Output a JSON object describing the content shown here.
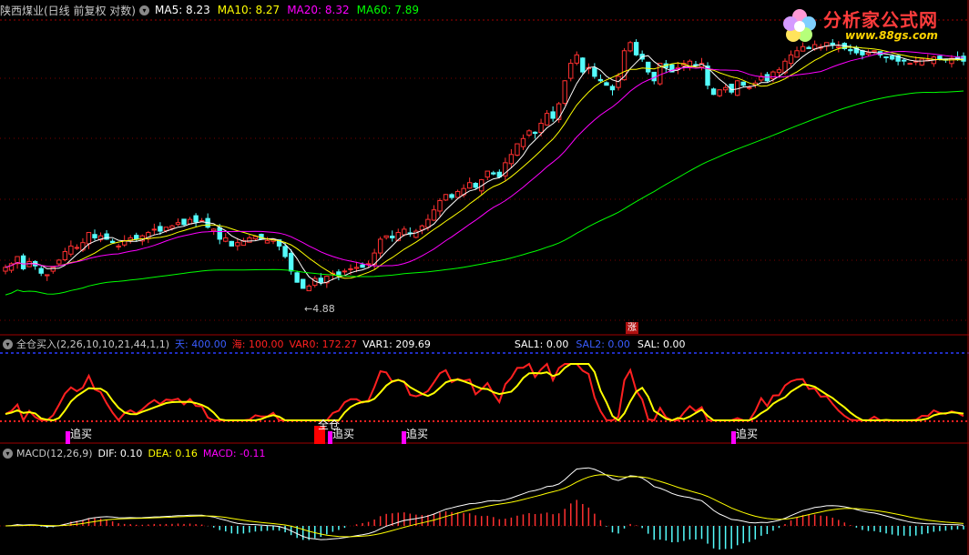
{
  "watermark": {
    "brand": "分析家公式网",
    "url": "www.88gs.com"
  },
  "main_panel": {
    "title": "陕西煤业(日线 前复权 对数)",
    "indicators": [
      {
        "label": "MA5: 8.23",
        "color": "#ffffff"
      },
      {
        "label": "MA10: 8.27",
        "color": "#ffff00"
      },
      {
        "label": "MA20: 8.32",
        "color": "#ff00ff"
      },
      {
        "label": "MA60: 7.89",
        "color": "#00ff00"
      }
    ],
    "low_marker": "←4.88",
    "zhang_tag": "涨"
  },
  "sub_panel": {
    "title": "全仓买入(2,26,10,10,21,44,1,1)",
    "indicators": [
      {
        "label": "天: 400.00",
        "color": "#3a5cff"
      },
      {
        "label": "海: 100.00",
        "color": "#ff2020"
      },
      {
        "label": "VAR0: 172.27",
        "color": "#ff2020"
      },
      {
        "label": "VAR1: 209.69",
        "color": "#ffffff"
      },
      {
        "label": "SAL1: 0.00",
        "color": "#ffffff"
      },
      {
        "label": "SAL2: 0.00",
        "color": "#3a5cff"
      },
      {
        "label": "SAL: 0.00",
        "color": "#ffffff"
      }
    ],
    "signals": [
      "追买",
      "全仓",
      "追买",
      "追买",
      "追买"
    ]
  },
  "macd_panel": {
    "title": "MACD(12,26,9)",
    "indicators": [
      {
        "label": "DIF: 0.10",
        "color": "#ffffff"
      },
      {
        "label": "DEA: 0.16",
        "color": "#ffff00"
      },
      {
        "label": "MACD: -0.11",
        "color": "#ff00ff"
      }
    ]
  },
  "colors": {
    "up": "#ff3030",
    "down": "#54fcfc",
    "ma5": "#ffffff",
    "ma10": "#ffff00",
    "ma20": "#ff00ff",
    "ma60": "#00ff00",
    "grid": "#7a0000",
    "border": "#a00000"
  },
  "chart_data": {
    "type": "candlestick",
    "close": [
      5.2,
      5.25,
      5.35,
      5.18,
      5.28,
      5.22,
      5.12,
      5.1,
      5.2,
      5.3,
      5.42,
      5.5,
      5.48,
      5.55,
      5.7,
      5.62,
      5.65,
      5.6,
      5.55,
      5.5,
      5.58,
      5.62,
      5.6,
      5.65,
      5.7,
      5.75,
      5.72,
      5.78,
      5.8,
      5.85,
      5.82,
      5.9,
      5.86,
      5.88,
      5.78,
      5.75,
      5.6,
      5.62,
      5.5,
      5.55,
      5.58,
      5.62,
      5.64,
      5.6,
      5.58,
      5.6,
      5.5,
      5.35,
      5.15,
      5.0,
      4.92,
      4.95,
      5.05,
      5.0,
      5.08,
      5.12,
      5.1,
      5.15,
      5.18,
      5.2,
      5.2,
      5.25,
      5.4,
      5.6,
      5.65,
      5.62,
      5.7,
      5.75,
      5.68,
      5.72,
      5.8,
      5.9,
      6.05,
      6.2,
      6.3,
      6.25,
      6.35,
      6.4,
      6.5,
      6.42,
      6.55,
      6.7,
      6.65,
      6.6,
      6.85,
      7.0,
      7.2,
      7.3,
      7.45,
      7.4,
      7.6,
      7.8,
      7.7,
      8.0,
      8.5,
      8.9,
      9.1,
      8.7,
      8.8,
      8.6,
      8.5,
      8.4,
      8.3,
      8.6,
      9.2,
      9.4,
      9.1,
      9.0,
      8.7,
      8.5,
      8.9,
      8.8,
      8.7,
      8.8,
      8.9,
      8.95,
      8.85,
      8.9,
      8.4,
      8.2,
      8.3,
      8.35,
      8.25,
      8.5,
      8.4,
      8.35,
      8.45,
      8.6,
      8.5,
      8.7,
      8.75,
      8.95,
      9.1,
      9.2,
      9.3,
      9.25,
      9.35,
      9.3,
      9.4,
      9.35,
      9.3,
      9.25,
      9.2,
      9.15,
      9.1,
      9.15,
      9.2,
      9.1,
      9.05,
      9.0,
      8.95,
      8.97,
      8.9,
      8.95,
      9.0,
      8.98,
      9.05,
      9.0,
      8.98,
      9.02,
      9.0,
      8.95
    ],
    "ylim": [
      4.6,
      9.6
    ],
    "low_label": 4.88,
    "ma": {
      "MA5": 8.23,
      "MA10": 8.27,
      "MA20": 8.32,
      "MA60": 7.89
    }
  }
}
